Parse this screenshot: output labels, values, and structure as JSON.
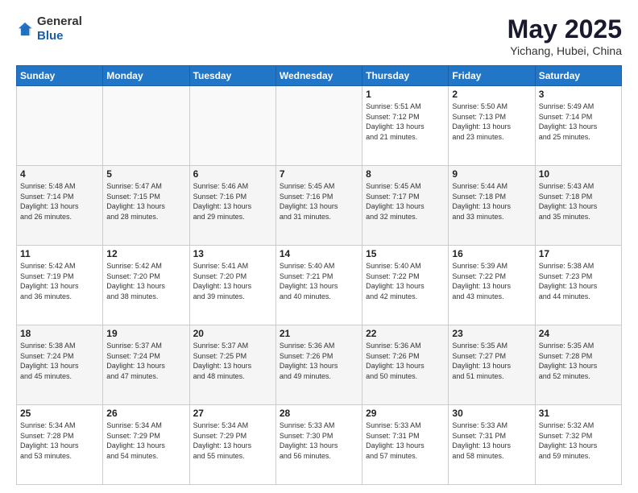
{
  "header": {
    "logo_general": "General",
    "logo_blue": "Blue",
    "title": "May 2025",
    "location": "Yichang, Hubei, China"
  },
  "weekdays": [
    "Sunday",
    "Monday",
    "Tuesday",
    "Wednesday",
    "Thursday",
    "Friday",
    "Saturday"
  ],
  "weeks": [
    [
      {
        "day": "",
        "info": ""
      },
      {
        "day": "",
        "info": ""
      },
      {
        "day": "",
        "info": ""
      },
      {
        "day": "",
        "info": ""
      },
      {
        "day": "1",
        "info": "Sunrise: 5:51 AM\nSunset: 7:12 PM\nDaylight: 13 hours\nand 21 minutes."
      },
      {
        "day": "2",
        "info": "Sunrise: 5:50 AM\nSunset: 7:13 PM\nDaylight: 13 hours\nand 23 minutes."
      },
      {
        "day": "3",
        "info": "Sunrise: 5:49 AM\nSunset: 7:14 PM\nDaylight: 13 hours\nand 25 minutes."
      }
    ],
    [
      {
        "day": "4",
        "info": "Sunrise: 5:48 AM\nSunset: 7:14 PM\nDaylight: 13 hours\nand 26 minutes."
      },
      {
        "day": "5",
        "info": "Sunrise: 5:47 AM\nSunset: 7:15 PM\nDaylight: 13 hours\nand 28 minutes."
      },
      {
        "day": "6",
        "info": "Sunrise: 5:46 AM\nSunset: 7:16 PM\nDaylight: 13 hours\nand 29 minutes."
      },
      {
        "day": "7",
        "info": "Sunrise: 5:45 AM\nSunset: 7:16 PM\nDaylight: 13 hours\nand 31 minutes."
      },
      {
        "day": "8",
        "info": "Sunrise: 5:45 AM\nSunset: 7:17 PM\nDaylight: 13 hours\nand 32 minutes."
      },
      {
        "day": "9",
        "info": "Sunrise: 5:44 AM\nSunset: 7:18 PM\nDaylight: 13 hours\nand 33 minutes."
      },
      {
        "day": "10",
        "info": "Sunrise: 5:43 AM\nSunset: 7:18 PM\nDaylight: 13 hours\nand 35 minutes."
      }
    ],
    [
      {
        "day": "11",
        "info": "Sunrise: 5:42 AM\nSunset: 7:19 PM\nDaylight: 13 hours\nand 36 minutes."
      },
      {
        "day": "12",
        "info": "Sunrise: 5:42 AM\nSunset: 7:20 PM\nDaylight: 13 hours\nand 38 minutes."
      },
      {
        "day": "13",
        "info": "Sunrise: 5:41 AM\nSunset: 7:20 PM\nDaylight: 13 hours\nand 39 minutes."
      },
      {
        "day": "14",
        "info": "Sunrise: 5:40 AM\nSunset: 7:21 PM\nDaylight: 13 hours\nand 40 minutes."
      },
      {
        "day": "15",
        "info": "Sunrise: 5:40 AM\nSunset: 7:22 PM\nDaylight: 13 hours\nand 42 minutes."
      },
      {
        "day": "16",
        "info": "Sunrise: 5:39 AM\nSunset: 7:22 PM\nDaylight: 13 hours\nand 43 minutes."
      },
      {
        "day": "17",
        "info": "Sunrise: 5:38 AM\nSunset: 7:23 PM\nDaylight: 13 hours\nand 44 minutes."
      }
    ],
    [
      {
        "day": "18",
        "info": "Sunrise: 5:38 AM\nSunset: 7:24 PM\nDaylight: 13 hours\nand 45 minutes."
      },
      {
        "day": "19",
        "info": "Sunrise: 5:37 AM\nSunset: 7:24 PM\nDaylight: 13 hours\nand 47 minutes."
      },
      {
        "day": "20",
        "info": "Sunrise: 5:37 AM\nSunset: 7:25 PM\nDaylight: 13 hours\nand 48 minutes."
      },
      {
        "day": "21",
        "info": "Sunrise: 5:36 AM\nSunset: 7:26 PM\nDaylight: 13 hours\nand 49 minutes."
      },
      {
        "day": "22",
        "info": "Sunrise: 5:36 AM\nSunset: 7:26 PM\nDaylight: 13 hours\nand 50 minutes."
      },
      {
        "day": "23",
        "info": "Sunrise: 5:35 AM\nSunset: 7:27 PM\nDaylight: 13 hours\nand 51 minutes."
      },
      {
        "day": "24",
        "info": "Sunrise: 5:35 AM\nSunset: 7:28 PM\nDaylight: 13 hours\nand 52 minutes."
      }
    ],
    [
      {
        "day": "25",
        "info": "Sunrise: 5:34 AM\nSunset: 7:28 PM\nDaylight: 13 hours\nand 53 minutes."
      },
      {
        "day": "26",
        "info": "Sunrise: 5:34 AM\nSunset: 7:29 PM\nDaylight: 13 hours\nand 54 minutes."
      },
      {
        "day": "27",
        "info": "Sunrise: 5:34 AM\nSunset: 7:29 PM\nDaylight: 13 hours\nand 55 minutes."
      },
      {
        "day": "28",
        "info": "Sunrise: 5:33 AM\nSunset: 7:30 PM\nDaylight: 13 hours\nand 56 minutes."
      },
      {
        "day": "29",
        "info": "Sunrise: 5:33 AM\nSunset: 7:31 PM\nDaylight: 13 hours\nand 57 minutes."
      },
      {
        "day": "30",
        "info": "Sunrise: 5:33 AM\nSunset: 7:31 PM\nDaylight: 13 hours\nand 58 minutes."
      },
      {
        "day": "31",
        "info": "Sunrise: 5:32 AM\nSunset: 7:32 PM\nDaylight: 13 hours\nand 59 minutes."
      }
    ]
  ]
}
